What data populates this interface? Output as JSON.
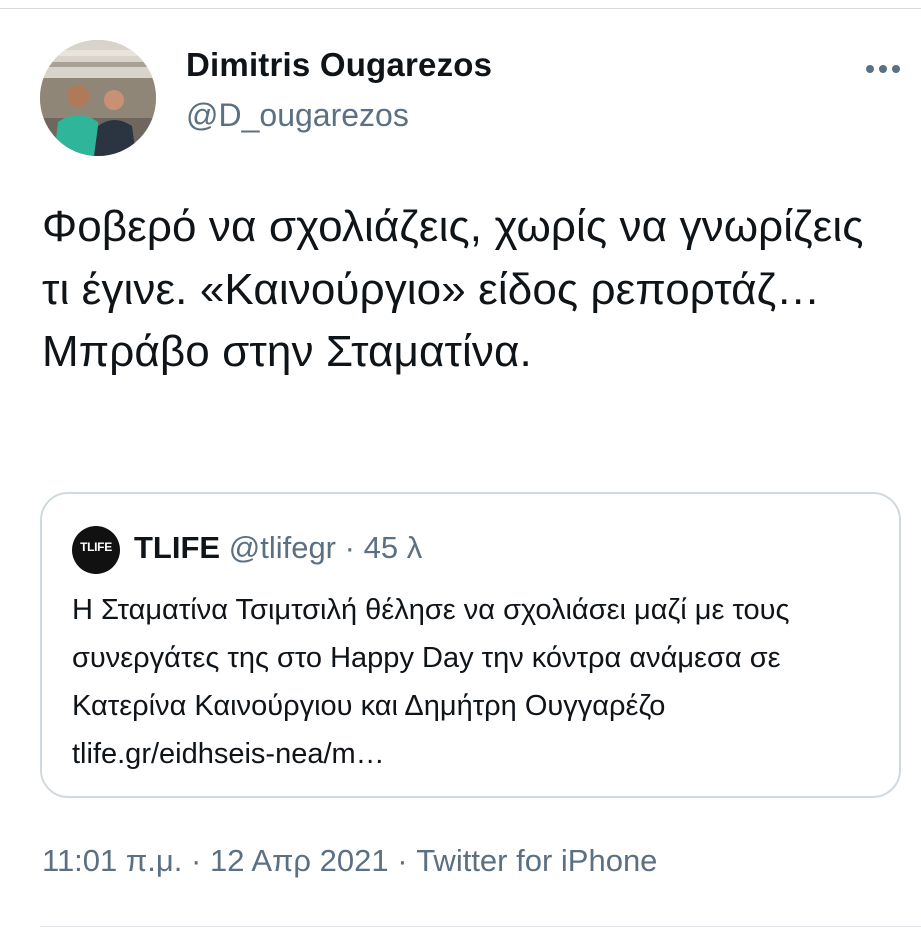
{
  "tweet": {
    "author_name": "Dimitris Ougarezos",
    "author_handle": "@D_ougarezos",
    "more_icon": "more-horizontal-icon",
    "text": "Φοβερό να σχολιάζεις, χωρίς να γνωρίζεις τι έγινε. «Καινούργιο» είδος ρεπορτάζ… Μπράβο στην Σταματίνα.",
    "quoted": {
      "avatar_logo_text": "TLIFE",
      "author_name": "TLIFE",
      "author_handle": "@tlifegr",
      "separator": "·",
      "time": "45 λ",
      "text": "Η Σταματίνα Τσιμτσιλή θέλησε να σχολιάσει μαζί με τους συνεργάτες της στο Happy Day την κόντρα ανάμεσα σε Κατερίνα Καινούργιου και Δημήτρη Ουγγαρέζο tlife.gr/eidhseis-nea/m…"
    },
    "meta": {
      "time": "11:01 π.μ.",
      "separator": "·",
      "date": "12 Απρ 2021",
      "source": "Twitter for iPhone"
    }
  },
  "colors": {
    "text_primary": "#0f1419",
    "text_secondary": "#5b7083",
    "border": "#cfd9de"
  }
}
